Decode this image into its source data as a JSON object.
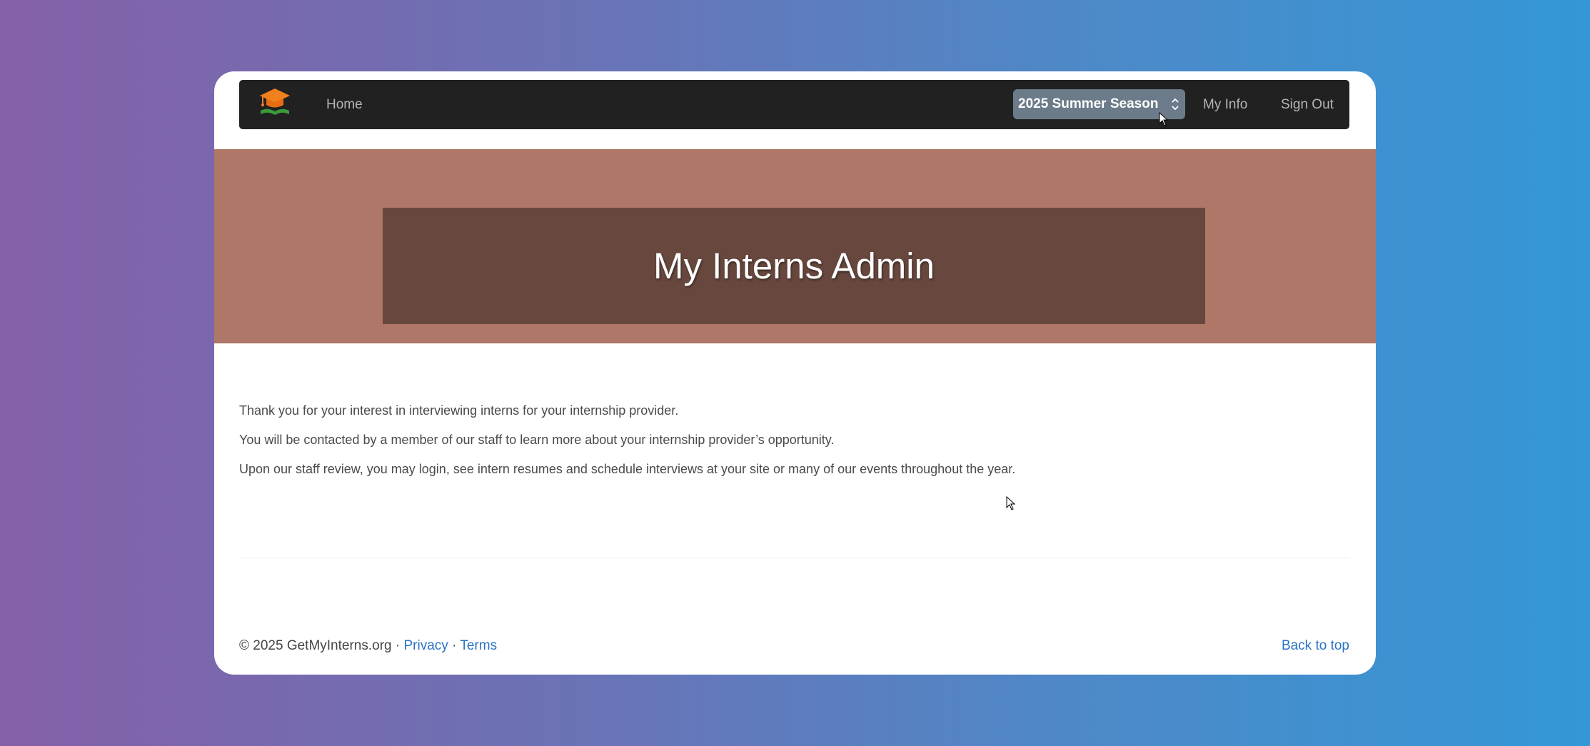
{
  "nav": {
    "logo_icon": "graduation-cap-icon",
    "home_label": "Home",
    "season_select": {
      "selected": "2025 Summer Season",
      "icon": "chevron-up-down-icon"
    },
    "my_info_label": "My Info",
    "sign_out_label": "Sign Out"
  },
  "hero": {
    "title": "My Interns Admin"
  },
  "content": {
    "paragraphs": [
      "Thank you for your interest in interviewing interns for your internship provider.",
      "You will be contacted by a member of our staff to learn more about your internship provider’s opportunity.",
      "Upon our staff review, you may login, see intern resumes and schedule interviews at your site or many of our events throughout the year."
    ]
  },
  "footer": {
    "copyright": "© 2025 GetMyInterns.org",
    "separator": "·",
    "privacy_label": "Privacy",
    "terms_label": "Terms",
    "back_to_top_label": "Back to top"
  },
  "colors": {
    "navbar": "#212121",
    "hero_background": "#ae7767",
    "hero_box": "#68483e",
    "link": "#2a73c2",
    "season_select": "#6b7b89"
  }
}
